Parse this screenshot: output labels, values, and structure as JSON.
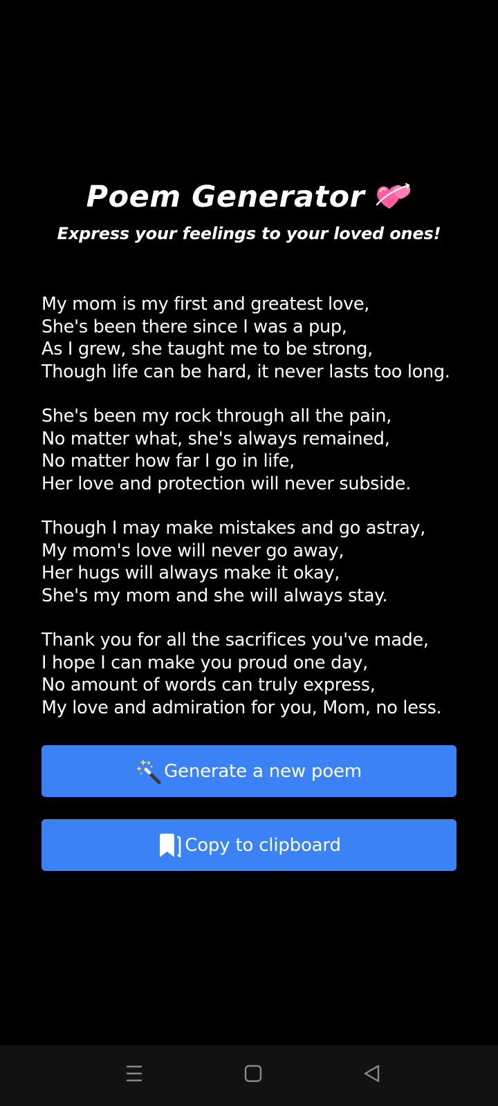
{
  "header": {
    "title": "Poem Generator",
    "title_icon": "two-hearts-icon",
    "subtitle": "Express your feelings to your loved ones!"
  },
  "poem": {
    "stanzas": [
      {
        "lines": [
          "My mom is my first and greatest love,",
          "She's been there since I was a pup,",
          "As I grew, she taught me to be strong,",
          "Though life can be hard, it never lasts too long."
        ]
      },
      {
        "lines": [
          "She's been my rock through all the pain,",
          "No matter what, she's always remained,",
          "No matter how far I go in life,",
          "Her love and protection will never subside."
        ]
      },
      {
        "lines": [
          "Though I may make mistakes and go astray,",
          "My mom's love will never go away,",
          "Her hugs will always make it okay,",
          "She's my mom and she will always stay."
        ]
      },
      {
        "lines": [
          "Thank you for all the sacrifices you've made,",
          "I hope I can make you proud one day,",
          "No amount of words can truly express,",
          "My love and admiration for you, Mom, no less."
        ]
      }
    ]
  },
  "buttons": {
    "generate": {
      "label": "Generate a new poem",
      "icon": "magic-wand-icon"
    },
    "copy": {
      "label": "Copy to clipboard",
      "icon": "bookmark-icon"
    }
  },
  "navbar": {
    "items": [
      "menu-icon",
      "home-icon",
      "back-icon"
    ]
  },
  "colors": {
    "background": "#000000",
    "text": "#ffffff",
    "button": "#3b82f6",
    "navbar": "#121212",
    "nav_icon": "#8a8a8a",
    "heart_pink": "#ff5fa2"
  }
}
